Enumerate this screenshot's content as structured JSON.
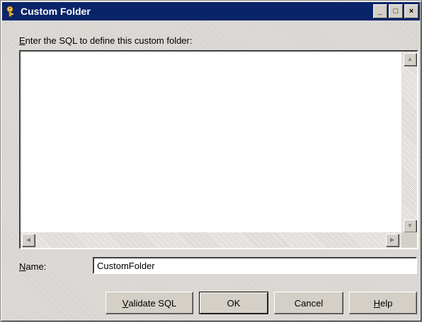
{
  "window": {
    "title": "Custom Folder",
    "controls": {
      "minimize": "_",
      "maximize": "□",
      "close": "×"
    }
  },
  "prompt": {
    "mnemonic": "E",
    "rest": "nter the SQL to define this custom folder:"
  },
  "sql_editor": {
    "value": "",
    "scroll_icons": {
      "up": "▲",
      "down": "▼",
      "left": "◀",
      "right": "▶"
    }
  },
  "name_field": {
    "label_mnemonic": "N",
    "label_rest": "ame:",
    "value": "CustomFolder"
  },
  "buttons": {
    "validate": {
      "mnemonic": "V",
      "rest": "alidate SQL"
    },
    "ok": {
      "label": "OK"
    },
    "cancel": {
      "label": "Cancel"
    },
    "help": {
      "mnemonic": "H",
      "rest": "elp"
    }
  },
  "colors": {
    "titlebar": "#0a246a",
    "face": "#d4d0c8"
  },
  "icons": {
    "title": "folder-key-icon"
  }
}
